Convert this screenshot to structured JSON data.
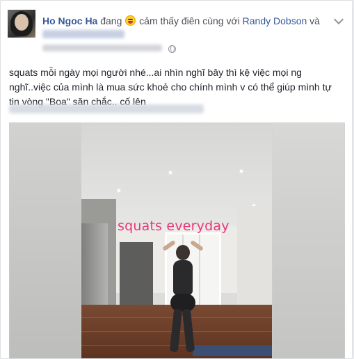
{
  "post": {
    "author": "Ho Ngoc Ha",
    "status_verb": "đang",
    "feeling_text": "cảm thấy điên cùng với",
    "tagged_friend": "Randy Dobson",
    "conjunction": "và",
    "body_line1": "squats mỗi ngày mọi người nhé...ai nhìn nghĩ bây thì kệ việc mọi ng",
    "body_line2": "nghĩ..việc của mình là mua sức khoẻ cho chính mình v có thể giúp mình tự",
    "body_line3": "tin vòng \"Boa\" săn chắc.. cố lên"
  },
  "icons": {
    "feeling": "grinning-tongue-emoji-icon",
    "audience": "globe-icon",
    "options": "chevron-down-icon"
  },
  "media": {
    "overlay_caption": "squats everyday",
    "caption_color": "#e8367a"
  },
  "colors": {
    "link": "#365899",
    "text": "#1d2129",
    "meta": "#90949c"
  }
}
